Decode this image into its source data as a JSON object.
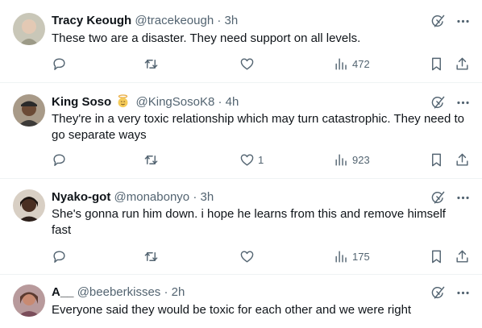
{
  "tweets": [
    {
      "name": "Tracy Keough",
      "handle": "@tracekeough",
      "time": "· 3h",
      "emoji": false,
      "text": "These two are a disaster. They need support on all levels.",
      "replies": "",
      "reposts": "",
      "likes": "",
      "views": "472",
      "avatar_color": "#b9b49f"
    },
    {
      "name": "King Soso",
      "handle": "@KingSosoK8",
      "time": "· 4h",
      "emoji": true,
      "emoji_icon": "angel-face-icon",
      "text": "They're in a very toxic relationship which may turn catastrophic.  They need to go separate ways",
      "replies": "",
      "reposts": "",
      "likes": "1",
      "views": "923",
      "avatar_color": "#5a4a3d"
    },
    {
      "name": "Nyako-got",
      "handle": "@monabonyo",
      "time": "· 3h",
      "emoji": false,
      "text": "She's gonna run him down. i hope he learns from this and remove himself fast",
      "replies": "",
      "reposts": "",
      "likes": "",
      "views": "175",
      "avatar_color": "#3a2b24"
    },
    {
      "name": "A__",
      "handle": "@beeberkisses",
      "time": "· 2h",
      "emoji": false,
      "text": "Everyone said they would be toxic for each other and we were right",
      "avatar_color": "#8c6a7a"
    }
  ],
  "icons": {
    "grok": "grok-icon",
    "more": "more-icon",
    "reply": "reply-icon",
    "repost": "repost-icon",
    "like": "heart-icon",
    "views": "views-icon",
    "bookmark": "bookmark-icon",
    "share": "share-icon"
  },
  "colors": {
    "text": "#0f1419",
    "secondary": "#536471",
    "divider": "#eff3f4",
    "background": "#ffffff"
  }
}
